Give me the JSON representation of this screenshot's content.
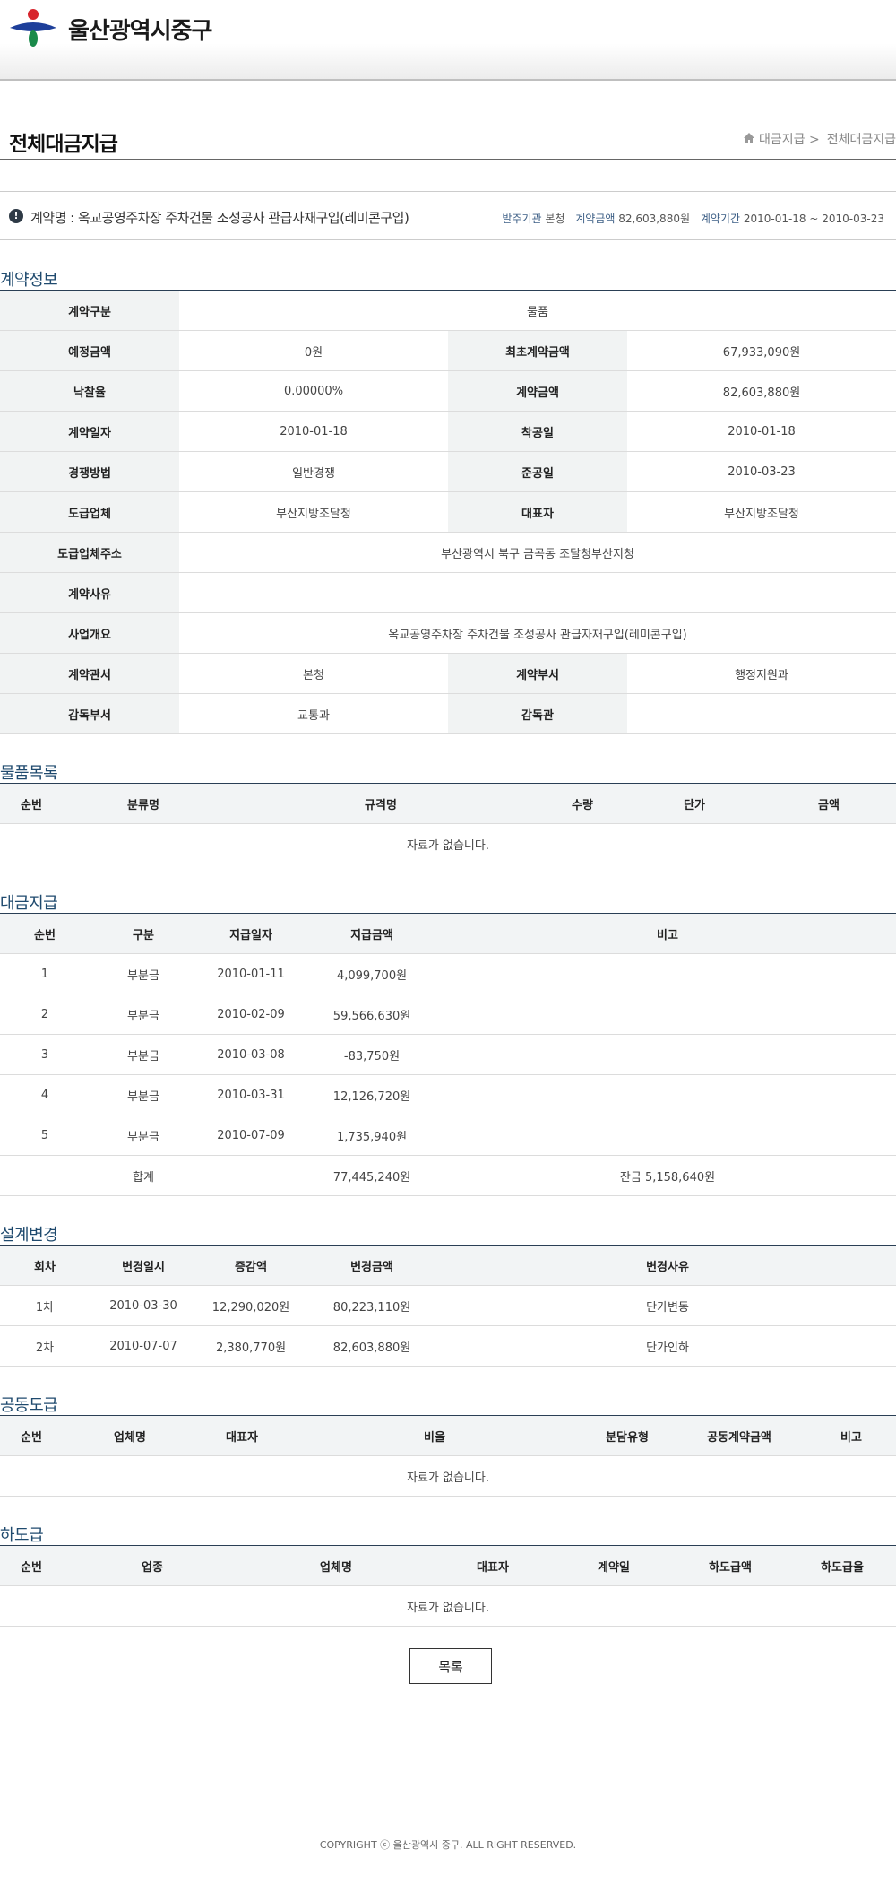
{
  "header": {
    "logo_text": "울산광역시중구"
  },
  "page": {
    "title": "전체대금지급",
    "breadcrumb": {
      "parent": "대금지급 >",
      "current": "전체대금지급"
    }
  },
  "contract": {
    "name": "계약명 : 옥교공영주차장 주차건물 조성공사 관급자재구입(레미콘구입)",
    "orderer_label": "발주기관",
    "orderer_value": "본청",
    "amount_label": "계약금액",
    "amount_value": "82,603,880원",
    "period_label": "계약기간",
    "period_value": "2010-01-18 ~ 2010-03-23"
  },
  "sections": {
    "contract_info": "계약정보",
    "items": "물품목록",
    "payments": "대금지급",
    "design_changes": "설계변경",
    "joint": "공동도급",
    "subcontract": "하도급"
  },
  "contract_info": {
    "r1": {
      "k1": "계약구분",
      "v1": "물품"
    },
    "r2": {
      "k1": "예정금액",
      "v1": "0원",
      "k2": "최초계약금액",
      "v2": "67,933,090원"
    },
    "r3": {
      "k1": "낙찰율",
      "v1": "0.00000%",
      "k2": "계약금액",
      "v2": "82,603,880원"
    },
    "r4": {
      "k1": "계약일자",
      "v1": "2010-01-18",
      "k2": "착공일",
      "v2": "2010-01-18"
    },
    "r5": {
      "k1": "경쟁방법",
      "v1": "일반경쟁",
      "k2": "준공일",
      "v2": "2010-03-23"
    },
    "r6": {
      "k1": "도급업체",
      "v1": "부산지방조달청",
      "k2": "대표자",
      "v2": "부산지방조달청"
    },
    "r7": {
      "k1": "도급업체주소",
      "v1": "부산광역시 북구 금곡동 조달청부산지청"
    },
    "r8": {
      "k1": "계약사유",
      "v1": ""
    },
    "r9": {
      "k1": "사업개요",
      "v1": "옥교공영주차장 주차건물 조성공사 관급자재구입(레미콘구입)"
    },
    "r10": {
      "k1": "계약관서",
      "v1": "본청",
      "k2": "계약부서",
      "v2": "행정지원과"
    },
    "r11": {
      "k1": "감독부서",
      "v1": "교통과",
      "k2": "감독관",
      "v2": ""
    }
  },
  "items_table": {
    "headers": [
      "순번",
      "분류명",
      "규격명",
      "수량",
      "단가",
      "금액"
    ],
    "empty": "자료가 없습니다."
  },
  "payments_table": {
    "headers": [
      "순번",
      "구분",
      "지급일자",
      "지급금액",
      "비고"
    ],
    "rows": [
      [
        "1",
        "부분금",
        "2010-01-11",
        "4,099,700원",
        ""
      ],
      [
        "2",
        "부분금",
        "2010-02-09",
        "59,566,630원",
        ""
      ],
      [
        "3",
        "부분금",
        "2010-03-08",
        "-83,750원",
        ""
      ],
      [
        "4",
        "부분금",
        "2010-03-31",
        "12,126,720원",
        ""
      ],
      [
        "5",
        "부분금",
        "2010-07-09",
        "1,735,940원",
        ""
      ]
    ],
    "total_label": "합계",
    "total_amount": "77,445,240원",
    "balance": "잔금 5,158,640원"
  },
  "design_table": {
    "headers": [
      "회차",
      "변경일시",
      "증감액",
      "변경금액",
      "변경사유"
    ],
    "rows": [
      [
        "1차",
        "2010-03-30",
        "12,290,020원",
        "80,223,110원",
        "단가변동"
      ],
      [
        "2차",
        "2010-07-07",
        "2,380,770원",
        "82,603,880원",
        "단가인하"
      ]
    ]
  },
  "joint_table": {
    "headers": [
      "순번",
      "업체명",
      "대표자",
      "비율",
      "분담유형",
      "공동계약금액",
      "비고"
    ],
    "empty": "자료가 없습니다."
  },
  "sub_table": {
    "headers": [
      "순번",
      "업종",
      "업체명",
      "대표자",
      "계약일",
      "하도급액",
      "하도급율"
    ],
    "empty": "자료가 없습니다."
  },
  "buttons": {
    "list": "목록"
  },
  "footer": {
    "copyright": "COPYRIGHT ⓒ 울산광역시 중구. ALL RIGHT RESERVED."
  },
  "colors": {
    "section_title": "#1f4a6e",
    "table_border": "#2a3f55",
    "header_bg": "#f1f3f3",
    "logo_blue": "#1e3f9a",
    "logo_red": "#d7252d",
    "logo_green": "#1a8a4a"
  }
}
